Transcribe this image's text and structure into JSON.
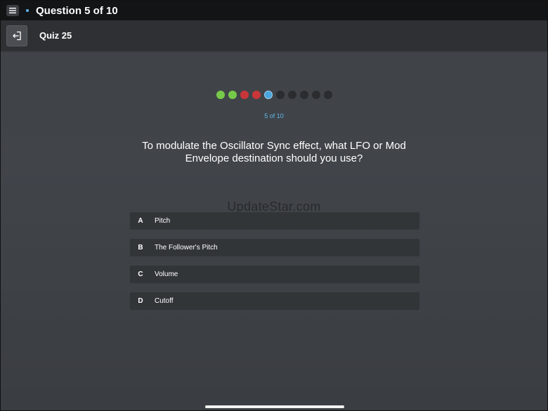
{
  "topbar": {
    "title": "Question 5 of 10",
    "menu_icon": "hamburger-icon",
    "accent": "#5db4ea"
  },
  "subheader": {
    "quiz_title": "Quiz 25",
    "exit_icon": "exit-icon"
  },
  "progress": {
    "label": "5 of 10",
    "current": 5,
    "total": 10,
    "states": [
      "correct",
      "correct",
      "wrong",
      "wrong",
      "current",
      "pending",
      "pending",
      "pending",
      "pending",
      "pending"
    ],
    "colors": {
      "correct": "#77c94a",
      "wrong": "#c9363a",
      "current": "#4aa5dd",
      "pending": "#2a2c2f"
    }
  },
  "question": {
    "text": "To modulate the Oscillator Sync effect, what LFO or Mod Envelope destination should you use?"
  },
  "watermark": "UpdateStar.com",
  "answers": [
    {
      "letter": "A",
      "text": "Pitch"
    },
    {
      "letter": "B",
      "text": "The Follower's Pitch"
    },
    {
      "letter": "C",
      "text": "Volume"
    },
    {
      "letter": "D",
      "text": "Cutoff"
    }
  ]
}
